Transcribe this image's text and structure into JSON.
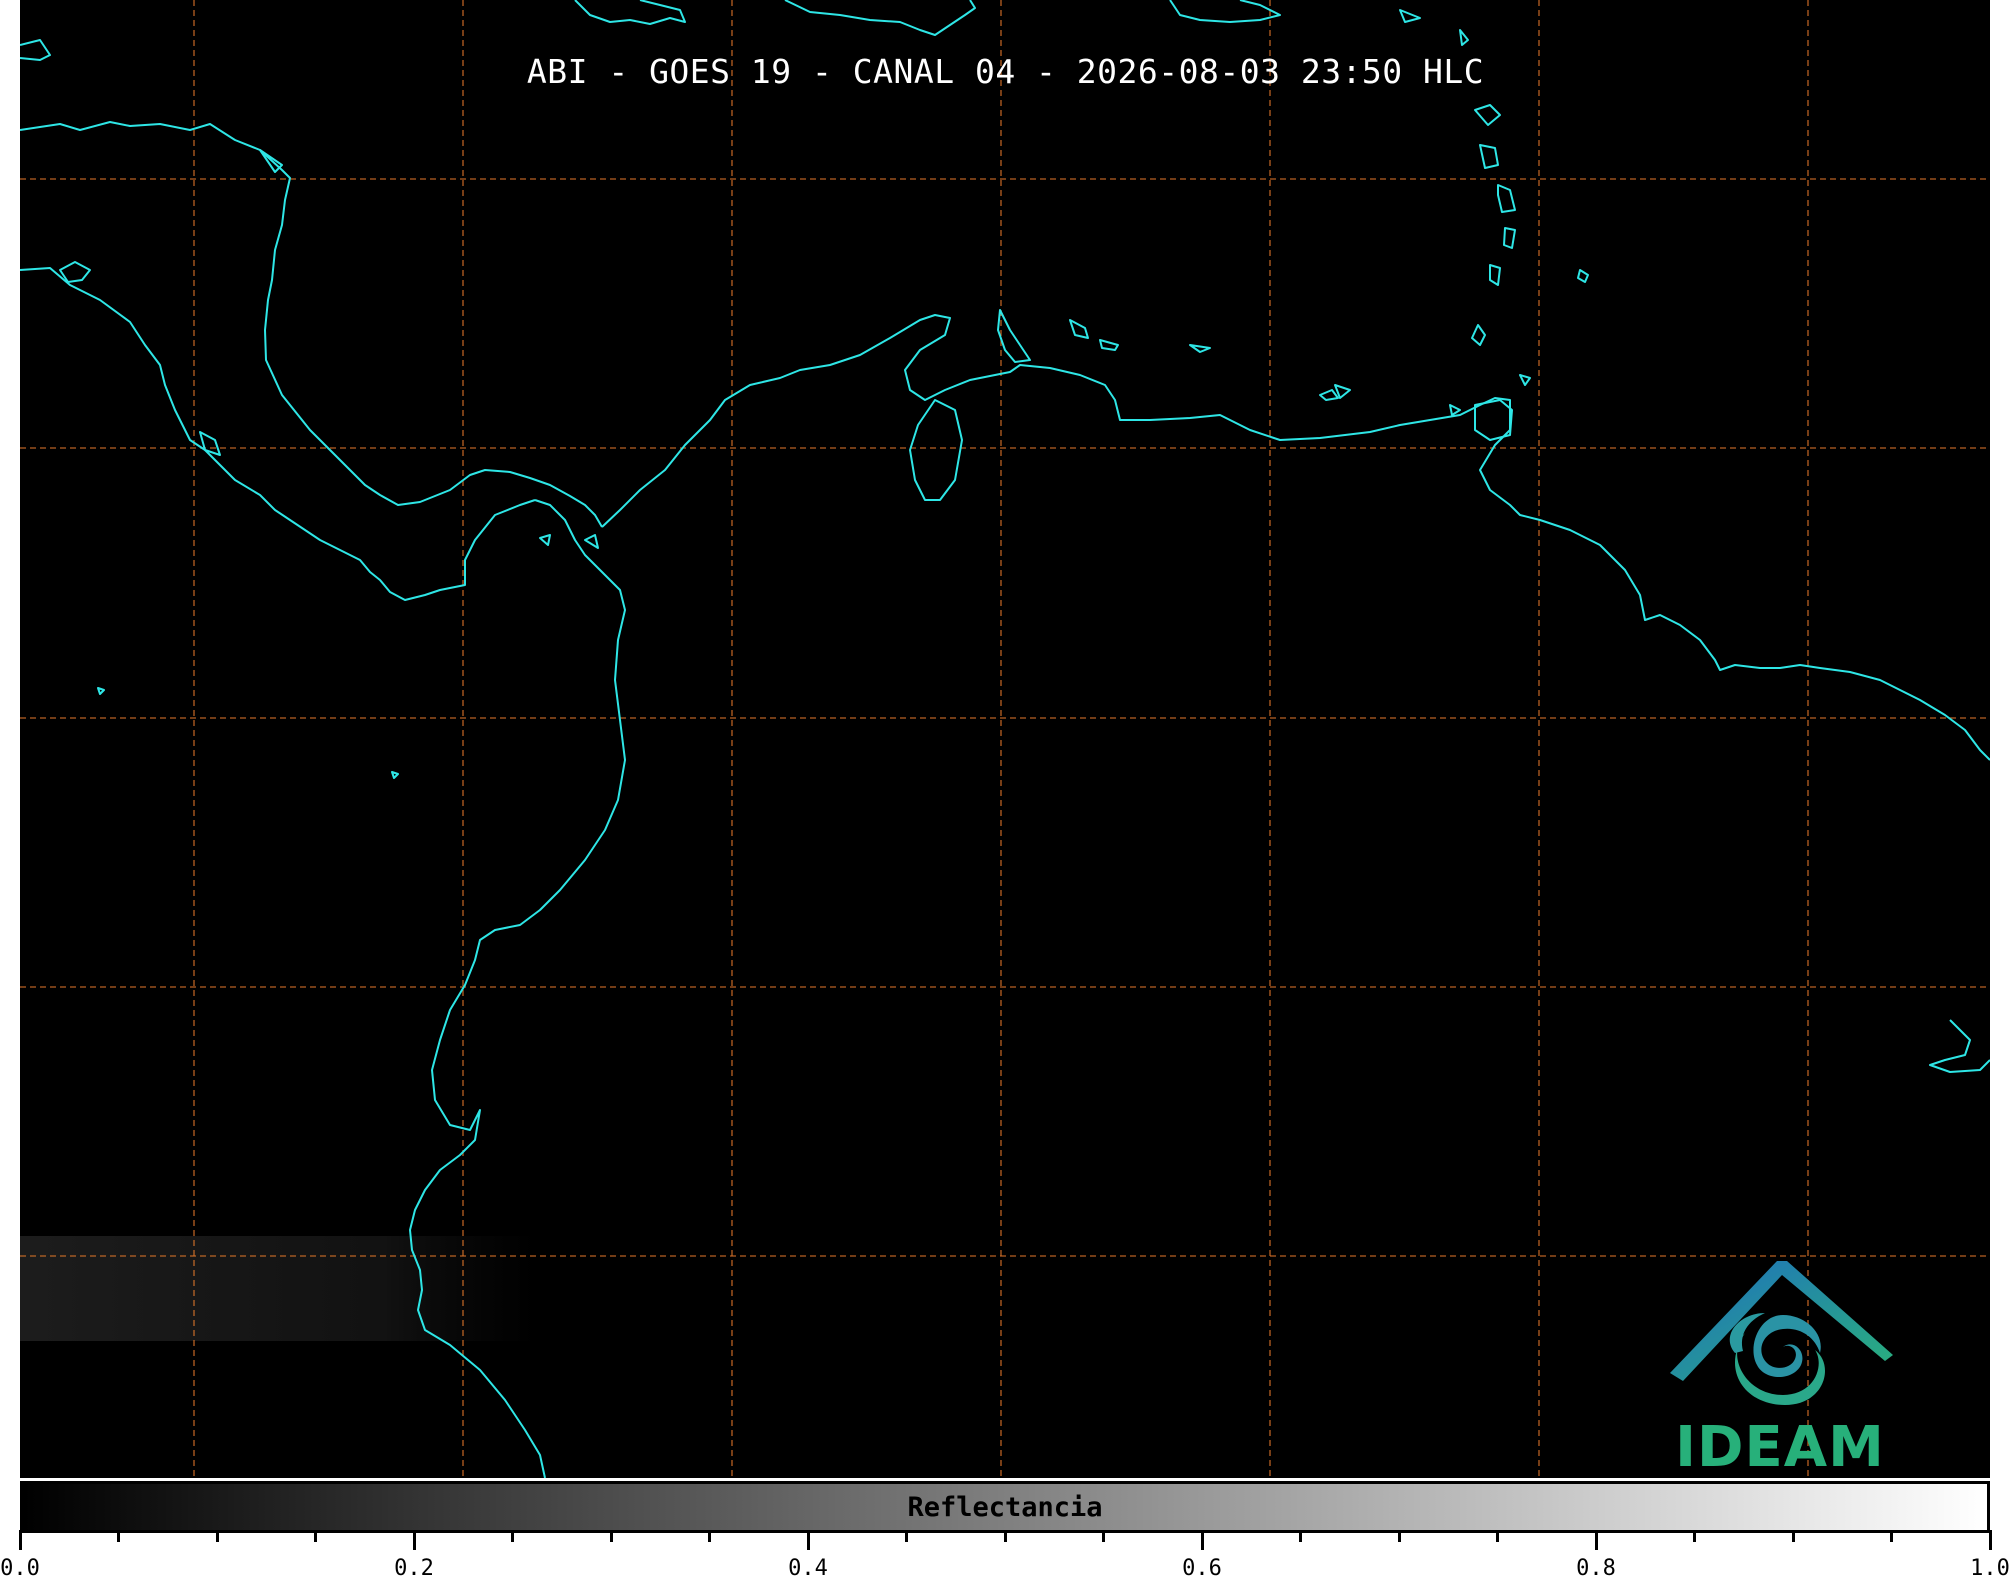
{
  "title": "ABI - GOES 19 - CANAL 04 - 2026-08-03 23:50 HLC",
  "colorbar": {
    "label": "Reflectancia",
    "min": 0.0,
    "max": 1.0,
    "tick_labels": [
      "0.0",
      "0.2",
      "0.4",
      "0.6",
      "0.8",
      "1.0"
    ]
  },
  "logo": {
    "text": "IDEAM"
  },
  "colors": {
    "coastline": "#2ee6e6",
    "grid": "#d9732a",
    "background": "#000000",
    "logo_blue": "#1f7fb5",
    "logo_green": "#27b07a"
  }
}
